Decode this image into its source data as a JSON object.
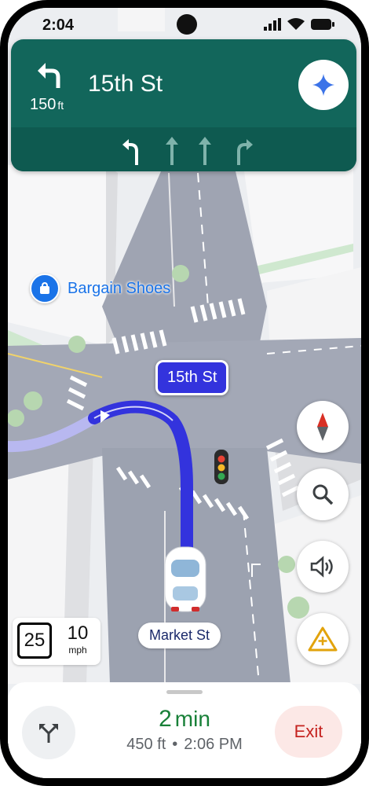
{
  "status_bar": {
    "time": "2:04"
  },
  "navigation": {
    "distance": "150",
    "distance_unit": "ft",
    "street": "15th St",
    "maneuver_icon": "turn-left-icon",
    "lanes": [
      "turn-left-active",
      "straight",
      "straight",
      "turn-right"
    ]
  },
  "map": {
    "poi_label": "Bargain Shoes",
    "turn_callout": "15th St",
    "current_road": "Market St"
  },
  "speed": {
    "limit": "25",
    "current": "10",
    "unit": "mph"
  },
  "side_buttons": [
    "compass-icon",
    "search-icon",
    "volume-icon",
    "report-incident-icon"
  ],
  "trip": {
    "eta_minutes": "2",
    "eta_unit": "min",
    "remaining_distance": "450 ft",
    "arrival_time": "2:06 PM",
    "exit_label": "Exit"
  },
  "colors": {
    "nav_green": "#12665b",
    "route_blue": "#3333dd",
    "eta_green": "#188038",
    "exit_red": "#c5221f"
  }
}
